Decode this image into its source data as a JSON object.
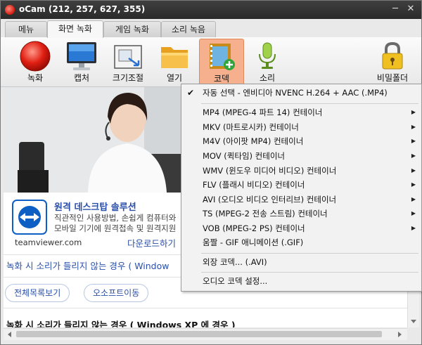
{
  "window": {
    "title": "oCam (212, 257, 627, 355)",
    "minimize_glyph": "─",
    "close_glyph": "✕"
  },
  "tabs": [
    {
      "label": "메뉴"
    },
    {
      "label": "화면 녹화"
    },
    {
      "label": "게임 녹화"
    },
    {
      "label": "소리 녹음"
    }
  ],
  "toolbar": {
    "record": "녹화",
    "capture": "캡처",
    "resize": "크기조절",
    "open": "열기",
    "codec": "코덱",
    "audio": "소리",
    "lock": "비밀폴더"
  },
  "page": {
    "ad_title": "원격 데스크탑 솔루션",
    "ad_body_1": "직관적인 사용방법, 손쉽게 컴퓨터와",
    "ad_body_2": "모바일 기기에 원격접속 및 원격지원",
    "ad_domain": "teamviewer.com",
    "ad_download": "다운로드하기",
    "article_link": "녹화 시 소리가 들리지 않는 경우 ( Window",
    "pill_all": "전체목록보기",
    "pill_ocam": "오소프트이동",
    "heading": "녹화 시 소리가 들리지 않는 경우 ( Windows XP 에 경우 )"
  },
  "codec_menu": {
    "checkmark": "✔",
    "submenu_glyph": "▶",
    "items": [
      {
        "label": "자동 선택 - 엔비디아 NVENC H.264 + AAC (.MP4)",
        "checked": true
      },
      {
        "label": "MP4 (MPEG-4 파트 14) 컨테이너",
        "submenu": true
      },
      {
        "label": "MKV (마트로시카) 컨테이너",
        "submenu": true
      },
      {
        "label": "M4V (아이팟 MP4) 컨테이너",
        "submenu": true
      },
      {
        "label": "MOV (퀵타임) 컨테이너",
        "submenu": true
      },
      {
        "label": "WMV (윈도우 미디어 비디오) 컨테이너",
        "submenu": true
      },
      {
        "label": "FLV (플래시 비디오) 컨테이너",
        "submenu": true
      },
      {
        "label": "AVI (오디오 비디오 인터리브) 컨테이너",
        "submenu": true
      },
      {
        "label": "TS (MPEG-2 전송 스트림) 컨테이너",
        "submenu": true
      },
      {
        "label": "VOB (MPEG-2 PS) 컨테이너",
        "submenu": true
      },
      {
        "label": "움짤 - GIF 애니메이션 (.GIF)"
      },
      {
        "label": "외장 코덱... (.AVI)"
      },
      {
        "label": "오디오 코덱 설정..."
      }
    ]
  },
  "colors": {
    "accent": "#f6b08e",
    "link": "#2a4fa8",
    "title_bg": "#2f2f2f"
  }
}
